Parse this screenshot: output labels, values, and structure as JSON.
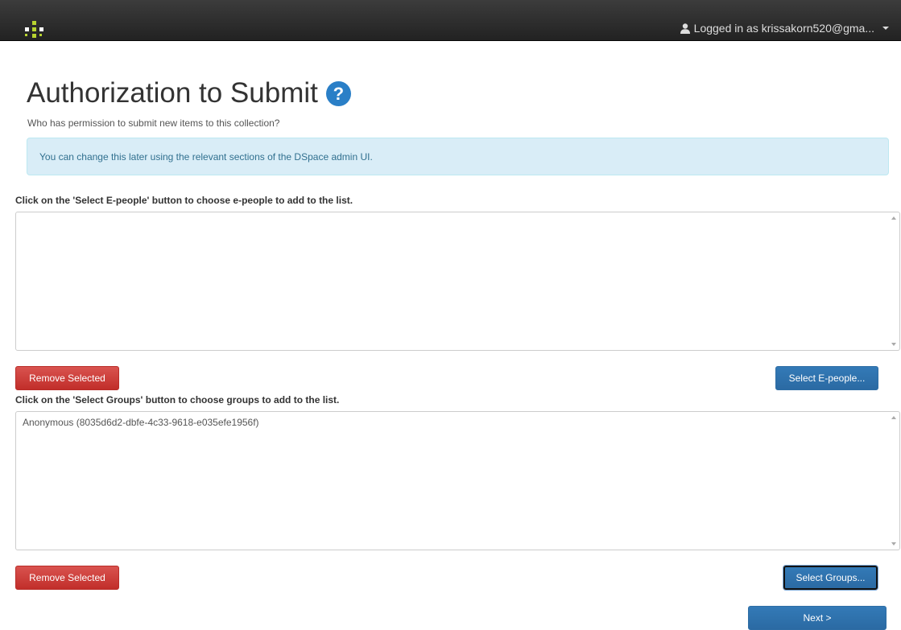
{
  "navbar": {
    "user_label": "Logged in as krissakorn520@gma...",
    "icons": [
      "dspace-logo-icon",
      "user-icon",
      "caret-down-icon"
    ],
    "logo_colors": [
      "#b8d430",
      "#ffffff"
    ]
  },
  "page": {
    "title": "Authorization to Submit",
    "help_glyph": "?",
    "subtitle": "Who has permission to submit new items to this collection?",
    "info_alert": "You can change this later using the relevant sections of the DSpace admin UI."
  },
  "eperson_section": {
    "instruction": "Click on the 'Select E-people' button to choose e-people to add to the list.",
    "items": [],
    "remove_label": "Remove Selected",
    "select_label": "Select E-people..."
  },
  "group_section": {
    "instruction": "Click on the 'Select Groups' button to choose groups to add to the list.",
    "items": [
      "Anonymous (8035d6d2-dbfe-4c33-9618-e035efe1956f)"
    ],
    "remove_label": "Remove Selected",
    "select_label": "Select Groups..."
  },
  "footer": {
    "next_label": "Next >"
  },
  "colors": {
    "navbar": "#222222",
    "danger": "#d9534f",
    "primary": "#337ab7",
    "info_bg": "#d9edf7",
    "info_text": "#31708f",
    "help_icon": "#2a7fc7"
  }
}
